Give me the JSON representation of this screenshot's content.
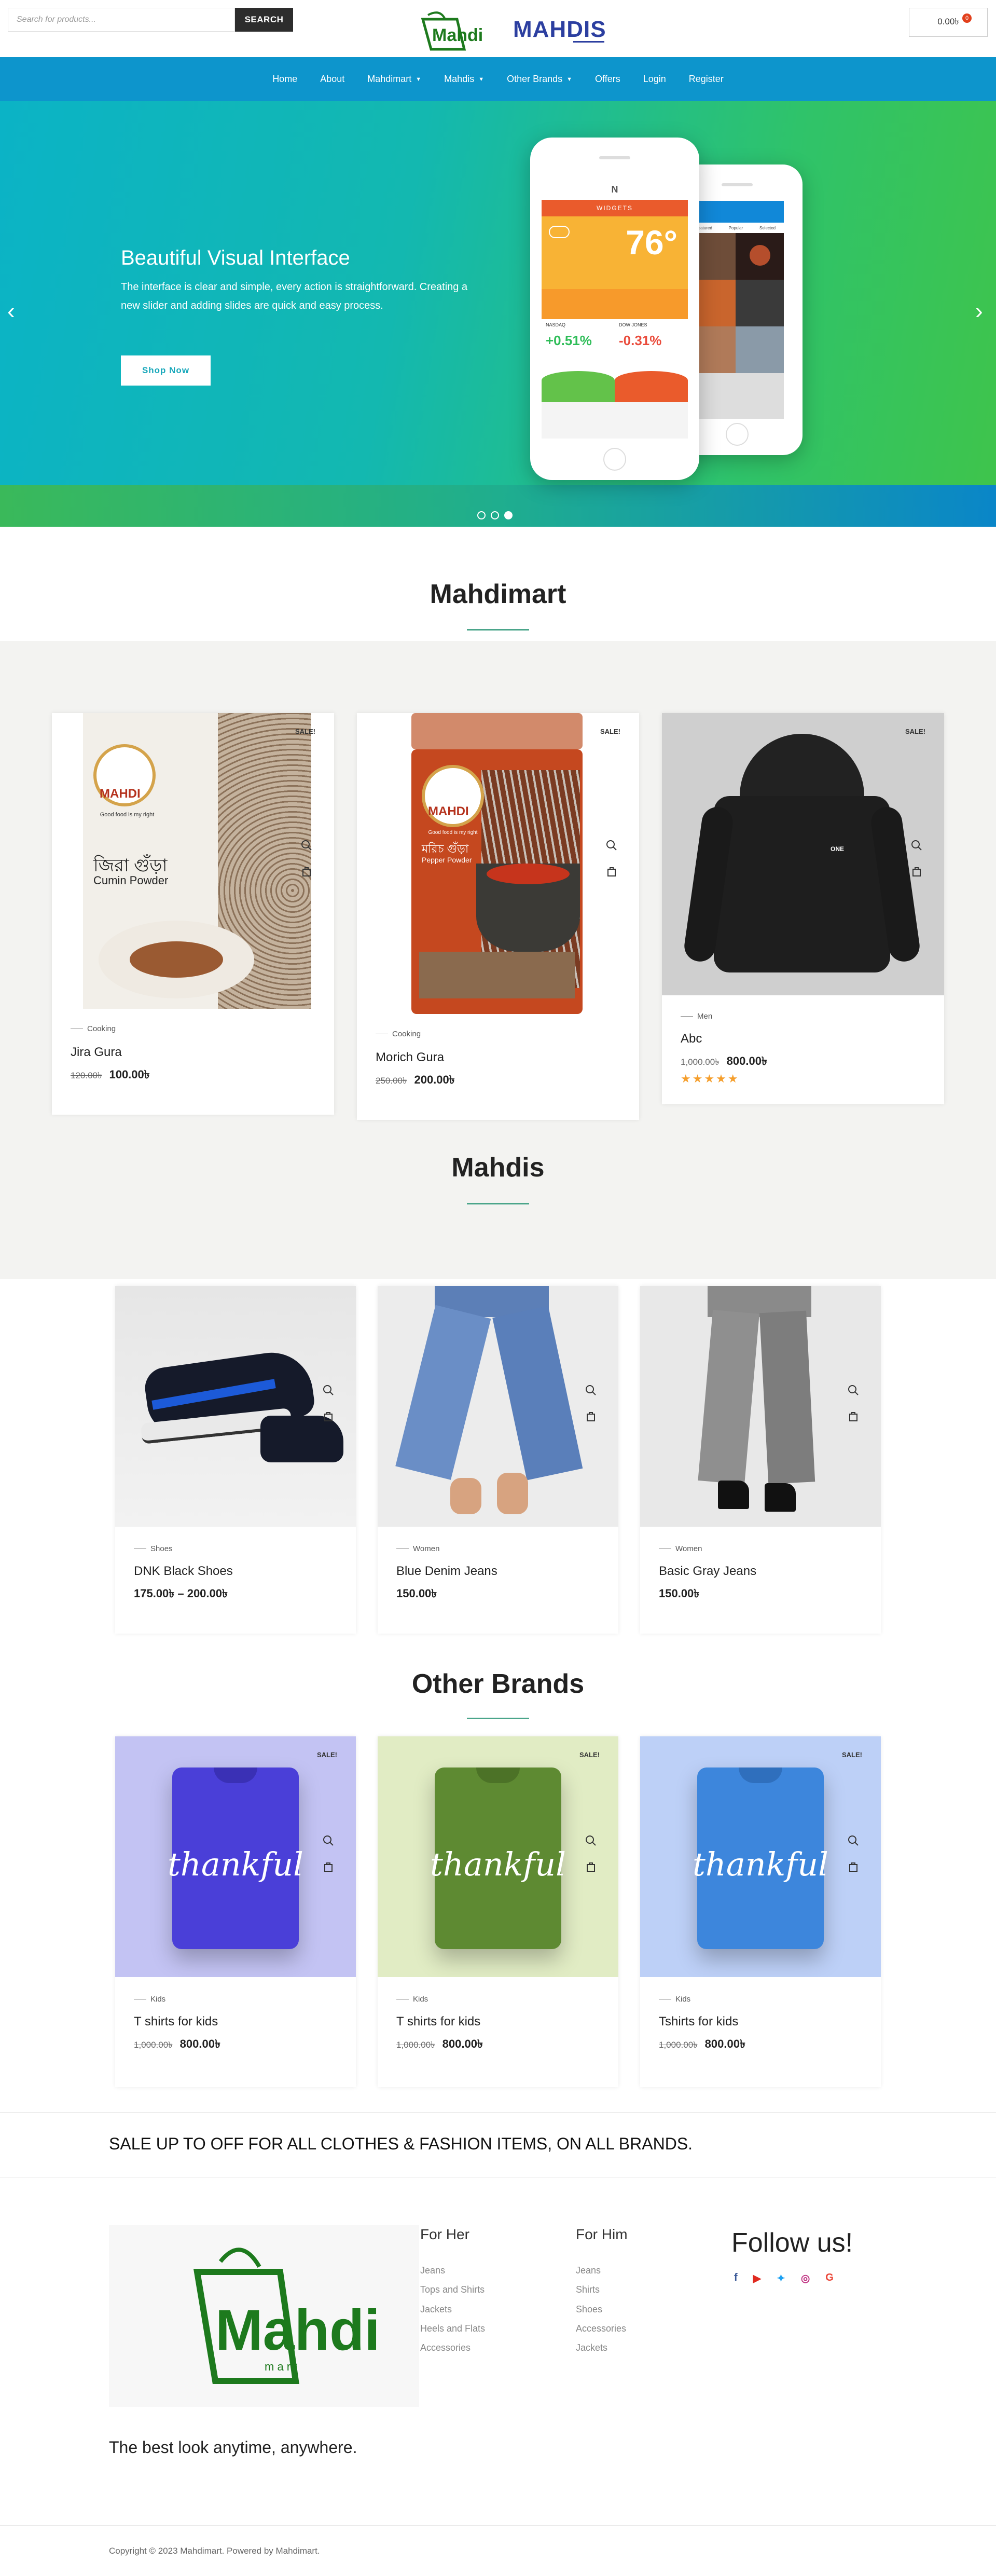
{
  "header": {
    "search_placeholder": "Search for products...",
    "search_button": "SEARCH",
    "cart_total": "0.00৳",
    "cart_count": "0",
    "logo_mart_text": "Mahdi",
    "logo_mahdis_text": "MAHDIS"
  },
  "nav": {
    "items": [
      {
        "label": "Home"
      },
      {
        "label": "About"
      },
      {
        "label": "Mahdimart"
      },
      {
        "label": "Mahdis"
      },
      {
        "label": "Other Brands"
      },
      {
        "label": "Offers"
      },
      {
        "label": "Login"
      },
      {
        "label": "Register"
      }
    ]
  },
  "hero": {
    "title": "Beautiful Visual Interface",
    "text": "The interface is clear and simple, every action is straightforward. Creating a new slider and adding slides are quick and easy process.",
    "button": "Shop Now",
    "slide_index": 3,
    "slide_count": 3,
    "phone": {
      "header": "WIDGETS",
      "temp": "76°",
      "stock1_name": "NASDAQ",
      "stock1_value": "+0.51%",
      "stock2_name": "DOW JONES",
      "stock2_value": "-0.31%",
      "tabs": [
        "Featured",
        "Popular",
        "Selected"
      ]
    },
    "colors": {
      "nav": "#0d95cc",
      "accent": "#16a7ba"
    }
  },
  "sections": {
    "mahdimart": "Mahdimart",
    "mahdis": "Mahdis",
    "other_brands": "Other Brands"
  },
  "mahdimart_products": [
    {
      "category": "Cooking",
      "name": "Jira Gura",
      "old_price": "120.00৳",
      "price": "100.00৳",
      "sale": "SALE!",
      "label_brand": "MAHDI",
      "label_tag": "Good food is my right",
      "label_bn": "জিরা গুঁড়া",
      "label_en": "Cumin Powder"
    },
    {
      "category": "Cooking",
      "name": "Morich Gura",
      "old_price": "250.00৳",
      "price": "200.00৳",
      "sale": "SALE!",
      "label_brand": "MAHDI",
      "label_tag": "Good food is my right",
      "label_bn": "মরিচ গুঁড়া",
      "label_en": "Pepper Powder"
    },
    {
      "category": "Men",
      "name": "Abc",
      "old_price": "1,000.00৳",
      "price": "800.00৳",
      "sale": "SALE!",
      "rating": 5,
      "print": "ONE"
    }
  ],
  "mahdis_products": [
    {
      "category": "Shoes",
      "name": "DNK Black Shoes",
      "price": "175.00৳ – 200.00৳"
    },
    {
      "category": "Women",
      "name": "Blue Denim Jeans",
      "price": "150.00৳"
    },
    {
      "category": "Women",
      "name": "Basic Gray Jeans",
      "price": "150.00৳"
    }
  ],
  "brand_products": [
    {
      "category": "Kids",
      "name": "T shirts for kids",
      "old_price": "1,000.00৳",
      "price": "800.00৳",
      "sale": "SALE!",
      "print": "thankful",
      "bg": "#c3c3f3",
      "shirt": "#4a3fd8"
    },
    {
      "category": "Kids",
      "name": "T shirts for kids",
      "old_price": "1,000.00৳",
      "price": "800.00৳",
      "sale": "SALE!",
      "print": "thankful",
      "bg": "#e1ecc4",
      "shirt": "#5e8a32"
    },
    {
      "category": "Kids",
      "name": "Tshirts for kids",
      "old_price": "1,000.00৳",
      "price": "800.00৳",
      "sale": "SALE!",
      "print": "thankful",
      "bg": "#bdd0f7",
      "shirt": "#3d86dc"
    }
  ],
  "banner": {
    "text": "SALE UP TO  OFF FOR ALL CLOTHES & FASHION ITEMS, ON ALL BRANDS."
  },
  "footer": {
    "logo_text": "Mahdi",
    "logo_sub": "m a r t",
    "for_her_title": "For Her",
    "for_her": [
      "Jeans",
      "Tops and Shirts",
      "Jackets",
      "Heels and Flats",
      "Accessories"
    ],
    "for_him_title": "For Him",
    "for_him": [
      "Jeans",
      "Shirts",
      "Shoes",
      "Accessories",
      "Jackets"
    ],
    "follow": "Follow us!",
    "social_icons": [
      "facebook-icon",
      "youtube-icon",
      "twitter-icon",
      "instagram-icon",
      "google-icon"
    ],
    "tagline": "The best look anytime, anywhere.",
    "copyright": "Copyright © 2023 Mahdimart. Powered by Mahdimart."
  }
}
